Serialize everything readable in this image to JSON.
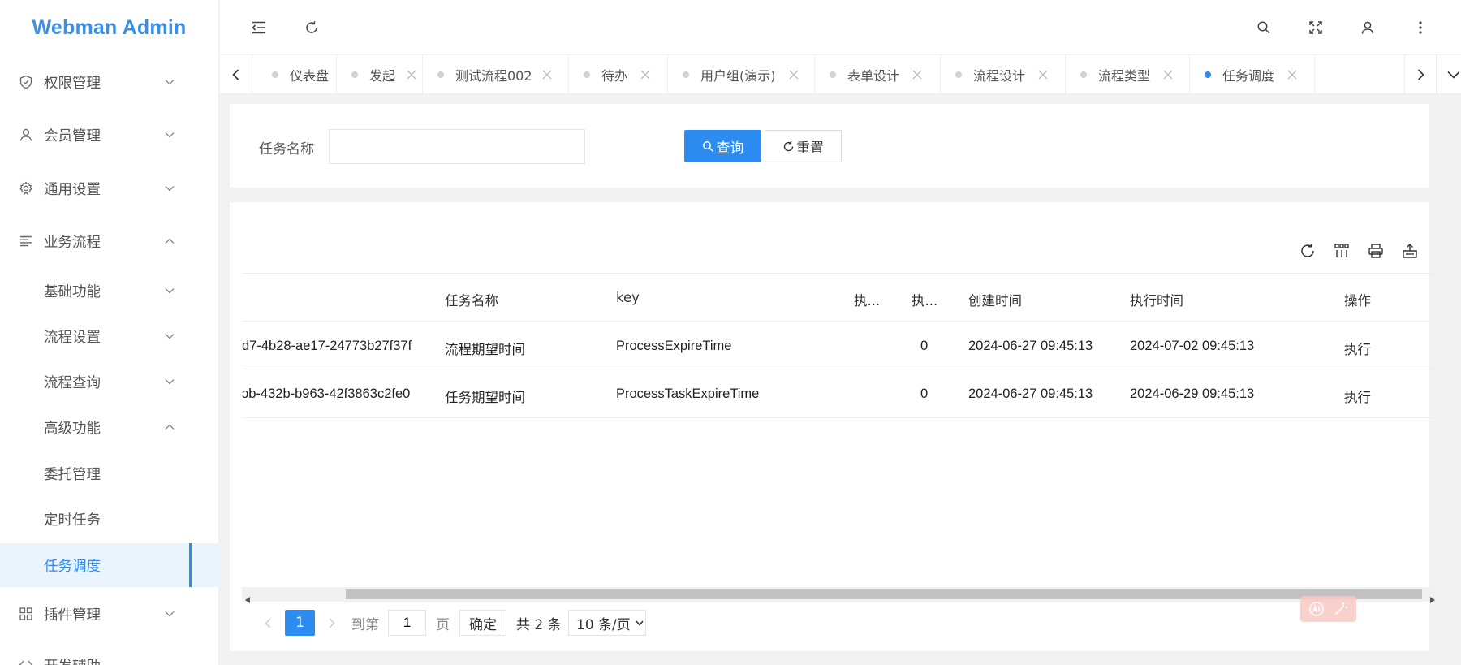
{
  "app": {
    "title": "Webman Admin"
  },
  "sidebar": {
    "items": [
      {
        "label": "权限管理"
      },
      {
        "label": "会员管理"
      },
      {
        "label": "通用设置"
      },
      {
        "label": "业务流程"
      },
      {
        "label": "基础功能"
      },
      {
        "label": "流程设置"
      },
      {
        "label": "流程查询"
      },
      {
        "label": "高级功能"
      },
      {
        "label": "委托管理"
      },
      {
        "label": "定时任务"
      },
      {
        "label": "任务调度"
      },
      {
        "label": "插件管理"
      },
      {
        "label": "开发辅助"
      }
    ]
  },
  "tabs": [
    {
      "label": "仪表盘"
    },
    {
      "label": "发起"
    },
    {
      "label": "测试流程002"
    },
    {
      "label": "待办"
    },
    {
      "label": "用户组(演示)"
    },
    {
      "label": "表单设计"
    },
    {
      "label": "流程设计"
    },
    {
      "label": "流程类型"
    },
    {
      "label": "任务调度"
    }
  ],
  "search": {
    "label": "任务名称",
    "value": "",
    "query_label": "查询",
    "reset_label": "重置"
  },
  "table": {
    "headers": [
      "任务名称",
      "key",
      "执...",
      "执...",
      "创建时间",
      "执行时间",
      "操作"
    ],
    "rows": [
      [
        "d7-4b28-ae17-24773b27f37f",
        "流程期望时间",
        "ProcessExpireTime",
        "0",
        "2024-06-27 09:45:13",
        "2024-07-02 09:45:13",
        "执行"
      ],
      [
        "ɔb-432b-b963-42f3863c2fe0",
        "任务期望时间",
        "ProcessTaskExpireTime",
        "0",
        "2024-06-27 09:45:13",
        "2024-06-29 09:45:13",
        "执行"
      ]
    ]
  },
  "pagination": {
    "current": "1",
    "goto_label": "到第",
    "goto_value": "1",
    "page_label": "页",
    "confirm_label": "确定",
    "total_label": "共 2 条",
    "page_size_label": "10 条/页"
  },
  "colors": {
    "accent": "#2d8cf0",
    "logo": "#3b8fe6"
  }
}
